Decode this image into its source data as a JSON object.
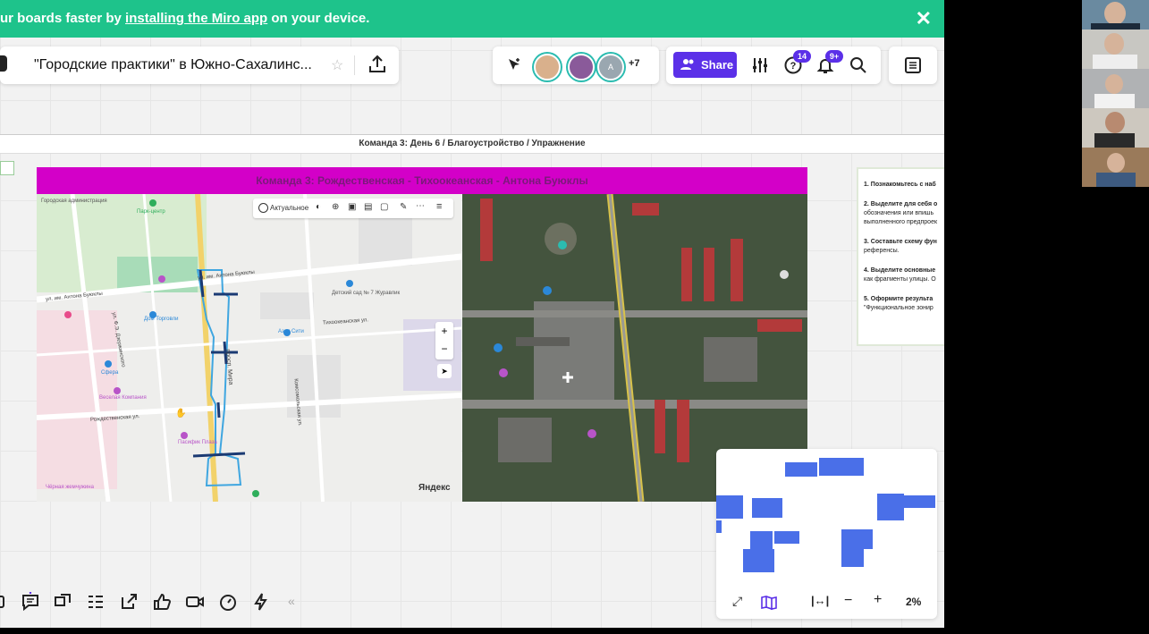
{
  "banner": {
    "prefix": "ur boards faster by ",
    "link": "installing the Miro app",
    "suffix": " on your device."
  },
  "board": {
    "title": "\"Городские практики\" в Южно-Сахалинс...",
    "collaborators_more": "+7",
    "avatar_initial": "A",
    "share_label": "Share",
    "help_badge": "14",
    "notif_badge": "9+"
  },
  "frame": {
    "title": "Команда 3: День 6 / Благоустройство / Упражнение",
    "header": "Команда 3: Рождественская - Тихоокеанская - Антона Буюклы"
  },
  "map": {
    "toolbar_label": "Актуальное",
    "brand": "Яндекс",
    "street_labels": [
      "ул. им. Антона Буюклы",
      "ул. им. Антона Буюклы",
      "Тихоокеанская ул.",
      "просп. Мира",
      "Рождественская ул.",
      "ул. Ф.Э. Дзержинского",
      "Комсомольская ул."
    ],
    "poi_labels": [
      "Дом Торговли",
      "Азия Сити",
      "Детский сад № 7 Журавлик",
      "Сфера",
      "Веселая Компания",
      "Пасифик Плаза",
      "Парк-центр",
      "Городская администрация",
      "Чёрная жемчужина"
    ]
  },
  "instructions": {
    "items": [
      {
        "n": "1.",
        "text": "Познакомьтесь с наб"
      },
      {
        "n": "2.",
        "text": "Выделите для себя о",
        "sub": [
          "обозначения или впишь",
          "выполненного предпроек"
        ]
      },
      {
        "n": "3.",
        "text": "Составьте схему фун",
        "sub": [
          "референсы."
        ]
      },
      {
        "n": "4.",
        "text": "Выделите основные",
        "sub": [
          "как фрагменты улицы. О"
        ]
      },
      {
        "n": "5.",
        "text": "Оформите результа",
        "sub": [
          "\"Функциональное зонир"
        ]
      }
    ]
  },
  "minimap": {
    "zoom": "2%"
  },
  "colors": {
    "banner": "#1ec38b",
    "accent": "#5b30e8",
    "frame_header": "#d300c8",
    "minimap_block": "#4a6fe8"
  }
}
